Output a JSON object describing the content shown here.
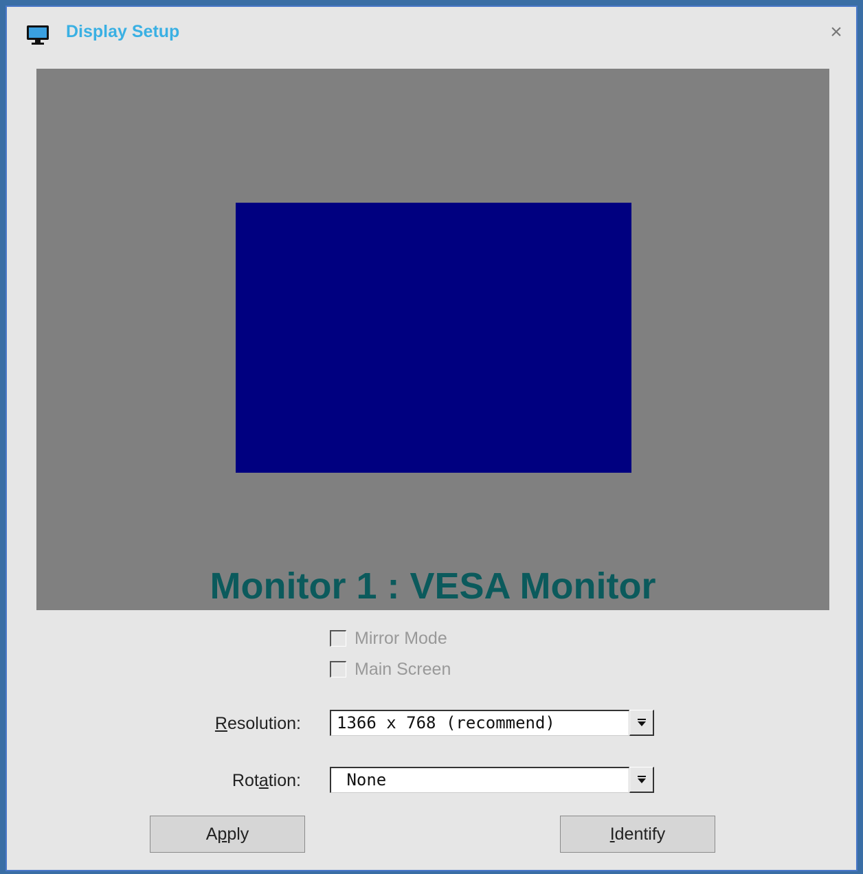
{
  "window": {
    "title": "Display Setup",
    "title_icon": "monitor-icon",
    "close_icon": "close-icon",
    "close_glyph": "×"
  },
  "preview": {
    "monitor_label": "Monitor 1 : VESA Monitor",
    "background_color": "#808080",
    "monitor_color": "#000080"
  },
  "options": {
    "mirror_mode": {
      "label": "Mirror Mode",
      "checked": false,
      "enabled": false
    },
    "main_screen": {
      "label": "Main Screen",
      "checked": false,
      "enabled": false
    }
  },
  "resolution": {
    "label_prefix": "",
    "label_mnemonic": "R",
    "label_suffix": "esolution:",
    "value": "1366 x 768 (recommend)"
  },
  "rotation": {
    "label_prefix": "Rot",
    "label_mnemonic": "a",
    "label_suffix": "tion:",
    "value": " None"
  },
  "buttons": {
    "apply_prefix": "A",
    "apply_mnemonic": "p",
    "apply_suffix": "ply",
    "identify_prefix": "",
    "identify_mnemonic": "I",
    "identify_suffix": "dentify"
  }
}
